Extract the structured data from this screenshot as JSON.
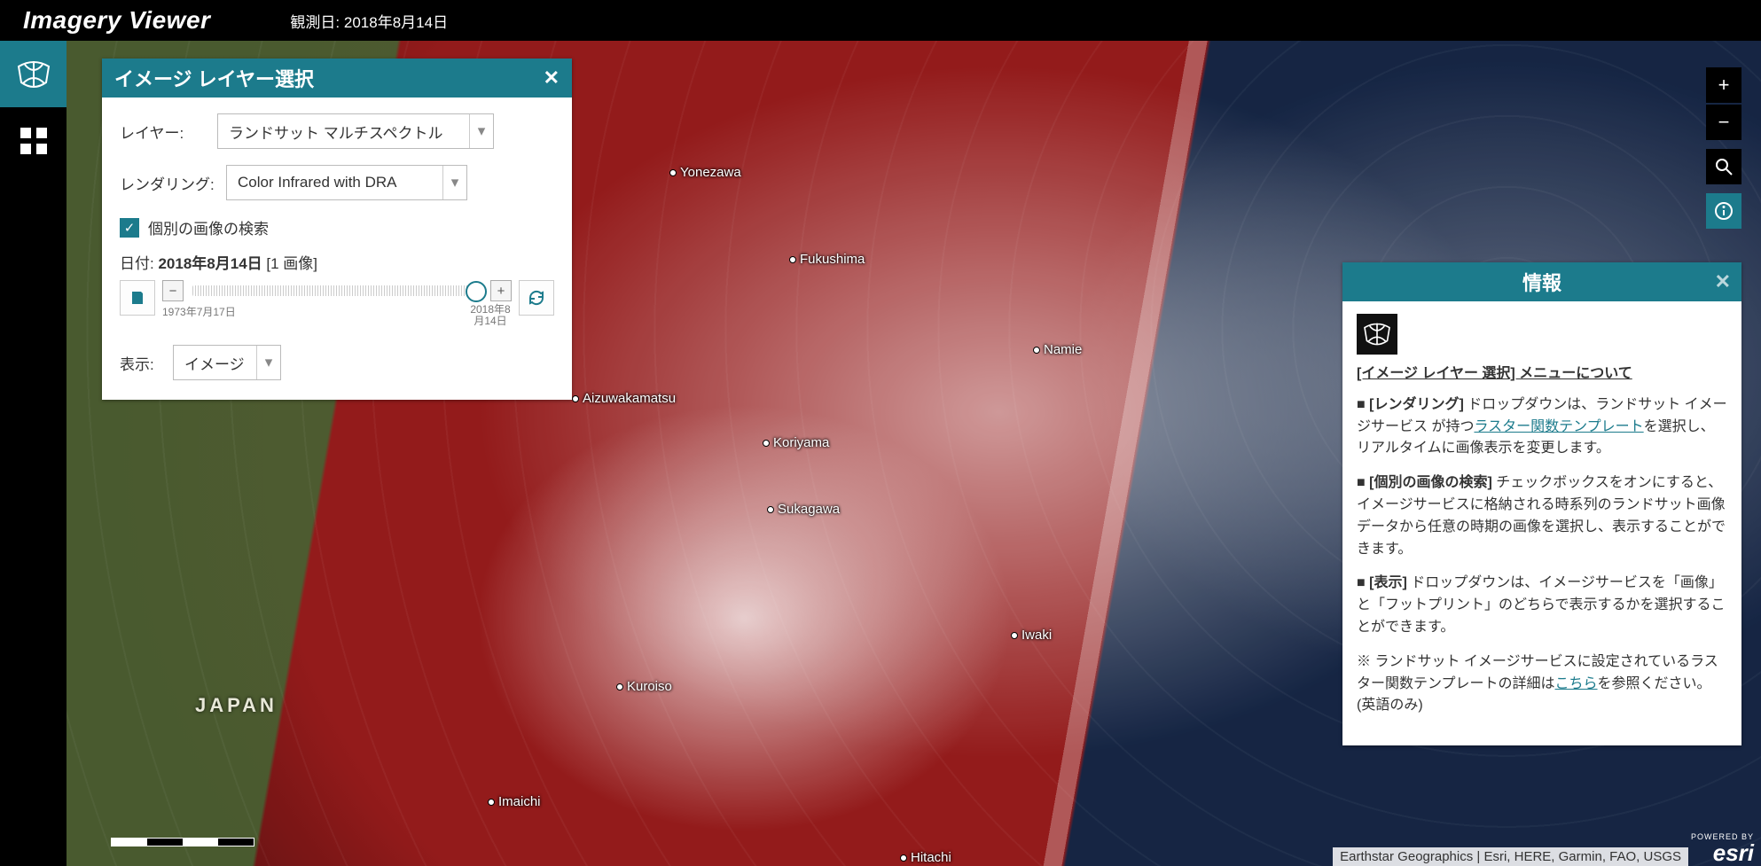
{
  "header": {
    "title": "Imagery Viewer",
    "date_prefix": "観測日:",
    "date_value": "2018年8月14日"
  },
  "sidebar": {
    "layer_tool": "イメージ レイヤー選択",
    "grid_tool": "ベースマップ"
  },
  "zoom": {
    "in": "+",
    "out": "−",
    "search": "⌕",
    "info": "ⓘ"
  },
  "layer_panel": {
    "title": "イメージ レイヤー選択",
    "layer_label": "レイヤー:",
    "layer_value": "ランドサット マルチスペクトル",
    "rendering_label": "レンダリング:",
    "rendering_value": "Color Infrared with DRA",
    "search_checkbox": "個別の画像の検索",
    "date_label": "日付:",
    "date_value": "2018年8月14日",
    "date_count": "[1 画像]",
    "slider_start": "1973年7月17日",
    "slider_end": "2018年8月14日",
    "display_label": "表示:",
    "display_value": "イメージ"
  },
  "info_panel": {
    "title": "情報",
    "heading": "[イメージ レイヤー 選択] メニューについて",
    "p1a": "■ ",
    "p1b": "[レンダリング]",
    "p1c": " ドロップダウンは、ランドサット イメージサービス が持つ",
    "p1link": "ラスター関数テンプレート",
    "p1d": "を選択し、リアルタイムに画像表示を変更します。",
    "p2a": "■ ",
    "p2b": "[個別の画像の検索]",
    "p2c": " チェックボックスをオンにすると、イメージサービスに格納される時系列のランドサット画像データから任意の時期の画像を選択し、表示することができます。",
    "p3a": "■ ",
    "p3b": "[表示]",
    "p3c": " ドロップダウンは、イメージサービスを「画像」と「フットプリント」のどちらで表示するかを選択することができます。",
    "p4a": "※ ランドサット イメージサービスに設定されているラスター関数テンプレートの詳細は",
    "p4link": "こちら",
    "p4b": "を参照ください。(英語のみ)"
  },
  "attribution": "Earthstar Geographics | Esri, HERE, Garmin, FAO, USGS",
  "esri": {
    "powered": "POWERED BY",
    "logo": "esri"
  },
  "cities": {
    "yonezawa": "Yonezawa",
    "fukushima": "Fukushima",
    "namie": "Namie",
    "aizu": "Aizuwakamatsu",
    "koriyama": "Koriyama",
    "sukagawa": "Sukagawa",
    "iwaki": "Iwaki",
    "kuroiso": "Kuroiso",
    "imaichi": "Imaichi",
    "hitachi": "Hitachi",
    "japan": "JAPAN"
  }
}
